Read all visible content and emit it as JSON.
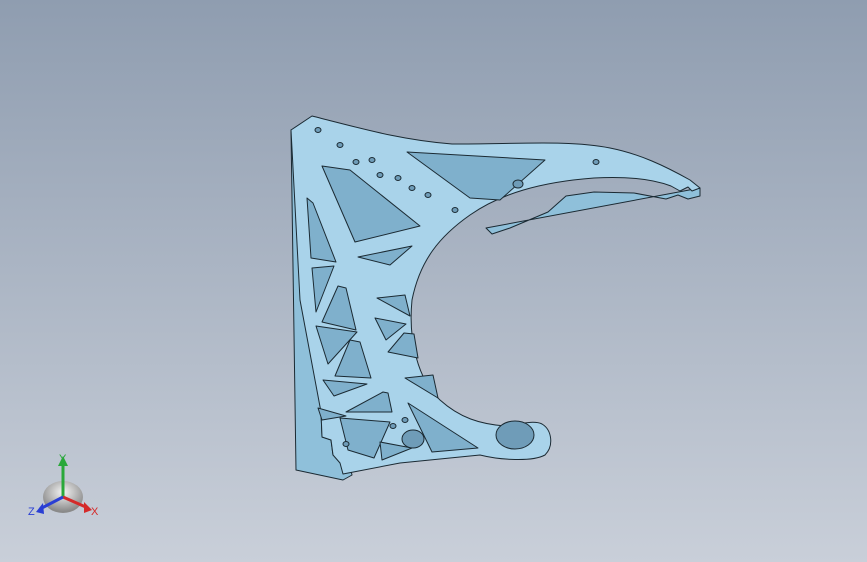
{
  "viewport": {
    "background_top": "#8f9db0",
    "background_bottom": "#c9cfd9",
    "part_color": "#a9d3ea",
    "part_edge_color": "#1b2a33",
    "part_side_color": "#8fc0da"
  },
  "triad": {
    "x_label": "X",
    "y_label": "Y",
    "z_label": "Z",
    "x_color": "#d42a2a",
    "y_color": "#29a83a",
    "z_color": "#2a3fd4"
  }
}
